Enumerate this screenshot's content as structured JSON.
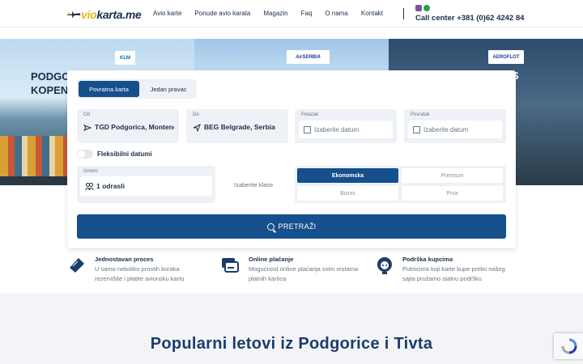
{
  "header": {
    "logo_text_1": "vio",
    "logo_text_2": "karta.me",
    "nav": [
      "Avio karte",
      "Ponude avio karata",
      "Magazin",
      "Faq",
      "O nama",
      "Kontakt"
    ],
    "call_center": "Call center +381 (0)62 4242 84"
  },
  "hero": {
    "city_left_1": "PODGO",
    "city_left_2": "KOPEN",
    "city_right": "S",
    "airline_1": "KLM",
    "airline_2": "AirSERBIA",
    "airline_3": "AEROFLOT"
  },
  "search": {
    "tabs": [
      "Povratna karta",
      "Jedan pravac"
    ],
    "from_label": "Od",
    "from_value": "TGD Podgorica, Montenegro",
    "to_label": "Do",
    "to_value": "BEG Belgrade, Serbia",
    "depart_label": "Polazak",
    "depart_placeholder": "Izaberite datum",
    "return_label": "Povratak",
    "return_placeholder": "Izaberite datum",
    "flexible": "Fleksibilni datumi",
    "pax_label": "Izmeni",
    "pax_value": "1 odrasli",
    "class_label": "Izaberite klase",
    "classes": [
      "Ekonomska",
      "Premium",
      "Biznis",
      "Prva"
    ],
    "button": "PRETRAŽI"
  },
  "features": [
    {
      "title": "Jednostavan proces",
      "line1": "U samo nekoliko prostih koraka",
      "line2": "rezervišite i platite avionsku kartu",
      "icon": "ticket-icon"
    },
    {
      "title": "Online plaćanje",
      "line1": "Mogućnost online plaćanja svim vrstama",
      "line2": "platnih kartica",
      "icon": "card-icon"
    },
    {
      "title": "Podrška kupcima",
      "line1": "Putnicima koji karte kupe preko našeg",
      "line2": "sajta pružamo stalnu podršku",
      "icon": "support-icon"
    }
  ],
  "popular_title": "Popularni letovi iz Podgorice i Tivta",
  "colors": {
    "primary": "#154f8c",
    "navy": "#1b2e4b",
    "accent": "#e7b416"
  }
}
